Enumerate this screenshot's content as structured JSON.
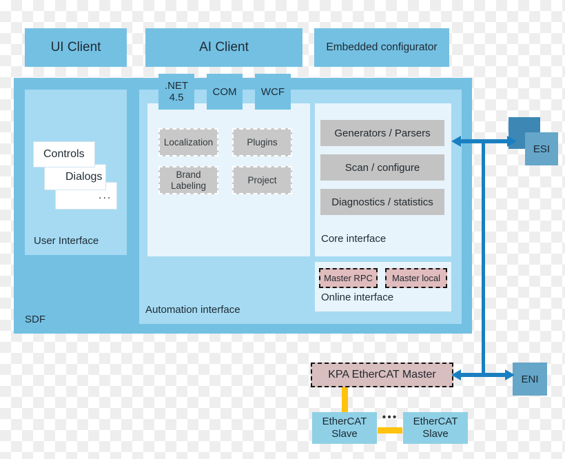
{
  "clients": [
    {
      "id": "ui-client",
      "label": "UI Client"
    },
    {
      "id": "ai-client",
      "label": "AI Client"
    },
    {
      "id": "embedded",
      "label": "Embedded configurator"
    }
  ],
  "apis": [
    {
      "id": "dotnet",
      "label": ".NET\n4.5",
      "line1": ".NET",
      "line2": "4.5"
    },
    {
      "id": "com",
      "label": "COM"
    },
    {
      "id": "wcf",
      "label": "WCF"
    }
  ],
  "sdf": {
    "label": "SDF",
    "user_interface": {
      "caption": "User Interface",
      "cards": [
        {
          "id": "controls",
          "label": "Controls"
        },
        {
          "id": "dialogs",
          "label": "Dialogs"
        },
        {
          "id": "more",
          "label": "..."
        }
      ]
    },
    "automation_interface": {
      "caption": "Automation interface",
      "modules": [
        {
          "id": "localization",
          "label": "Localization"
        },
        {
          "id": "plugins",
          "label": "Plugins"
        },
        {
          "id": "brand-labeling",
          "line1": "Brand",
          "line2": "Labeling"
        },
        {
          "id": "project",
          "label": "Project"
        }
      ]
    },
    "core_interface": {
      "caption": "Core interface",
      "items": [
        {
          "id": "generators-parsers",
          "label": "Generators / Parsers"
        },
        {
          "id": "scan-configure",
          "label": "Scan / configure"
        },
        {
          "id": "diagnostics-statistics",
          "label": "Diagnostics / statistics"
        }
      ]
    },
    "online_interface": {
      "caption": "Online interface",
      "items": [
        {
          "id": "master-rpc",
          "label": "Master RPC"
        },
        {
          "id": "master-local",
          "label": "Master local"
        }
      ]
    }
  },
  "artifacts": {
    "esi": "ESI",
    "eni": "ENI"
  },
  "master": {
    "label": "KPA EtherCAT Master"
  },
  "slaves": [
    {
      "id": "slave-left",
      "line1": "EtherCAT",
      "line2": "Slave"
    },
    {
      "id": "slave-right",
      "line1": "EtherCAT",
      "line2": "Slave"
    }
  ],
  "slave_ellipsis": "•••",
  "colors": {
    "client_blue": "#74c0e3",
    "sdf_blue": "#74c0e3",
    "panel_blue": "#a5daf2",
    "inner_panel": "#e8f4fb",
    "gray_box": "#c3c3c3",
    "pink_box": "#e0bcbe",
    "arrow_blue": "#1a7fc1",
    "bus_yellow": "#ffc20e",
    "artifact_blue": "#65a6c9",
    "artifact_blue_dark": "#3d87b5",
    "slave_blue": "#8fd0e6"
  }
}
